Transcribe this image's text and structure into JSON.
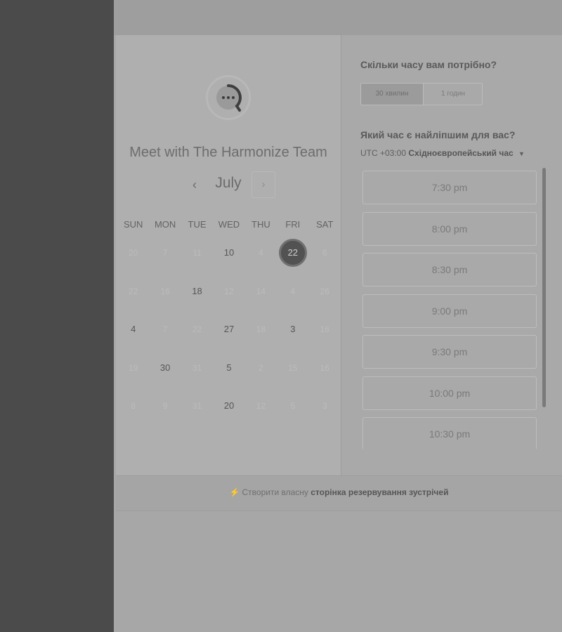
{
  "scheduler": {
    "org_title": "Meet with The Harmonize Team",
    "month": "July",
    "prev_icon": "‹",
    "next_icon": "›",
    "weekdays": [
      "SUN",
      "MON",
      "TUE",
      "WED",
      "THU",
      "FRI",
      "SAT"
    ],
    "weeks": [
      [
        {
          "d": "20",
          "a": false
        },
        {
          "d": "7",
          "a": false
        },
        {
          "d": "11",
          "a": false
        },
        {
          "d": "10",
          "a": true
        },
        {
          "d": "4",
          "a": false
        },
        {
          "d": "22",
          "a": true,
          "s": true
        },
        {
          "d": "6",
          "a": false
        }
      ],
      [
        {
          "d": "22",
          "a": false
        },
        {
          "d": "16",
          "a": false
        },
        {
          "d": "18",
          "a": true
        },
        {
          "d": "12",
          "a": false
        },
        {
          "d": "14",
          "a": false
        },
        {
          "d": "4",
          "a": false
        },
        {
          "d": "26",
          "a": false
        }
      ],
      [
        {
          "d": "4",
          "a": true
        },
        {
          "d": "7",
          "a": false
        },
        {
          "d": "22",
          "a": false
        },
        {
          "d": "27",
          "a": true
        },
        {
          "d": "18",
          "a": false
        },
        {
          "d": "3",
          "a": true
        },
        {
          "d": "16",
          "a": false
        }
      ],
      [
        {
          "d": "19",
          "a": false
        },
        {
          "d": "30",
          "a": true
        },
        {
          "d": "31",
          "a": false
        },
        {
          "d": "5",
          "a": true
        },
        {
          "d": "2",
          "a": false
        },
        {
          "d": "15",
          "a": false
        },
        {
          "d": "16",
          "a": false
        }
      ],
      [
        {
          "d": "8",
          "a": false
        },
        {
          "d": "9",
          "a": false
        },
        {
          "d": "31",
          "a": false
        },
        {
          "d": "20",
          "a": true
        },
        {
          "d": "12",
          "a": false
        },
        {
          "d": "5",
          "a": false
        },
        {
          "d": "3",
          "a": false
        }
      ]
    ]
  },
  "booking": {
    "duration_question": "Скільки часу вам потрібно?",
    "durations": [
      "30 хвилин",
      "1 годин"
    ],
    "time_question": "Який час є найліпшим для вас?",
    "timezone_offset": "UTC +03:00",
    "timezone_name": "Східноєвропейський час",
    "slots": [
      "7:30 pm",
      "8:00 pm",
      "8:30 pm",
      "9:00 pm",
      "9:30 pm",
      "10:00 pm",
      "10:30 pm"
    ]
  },
  "footer": {
    "icon": "⚡",
    "text_prefix": "Створити власну",
    "link_text": "сторінка резервування зустрічей"
  }
}
